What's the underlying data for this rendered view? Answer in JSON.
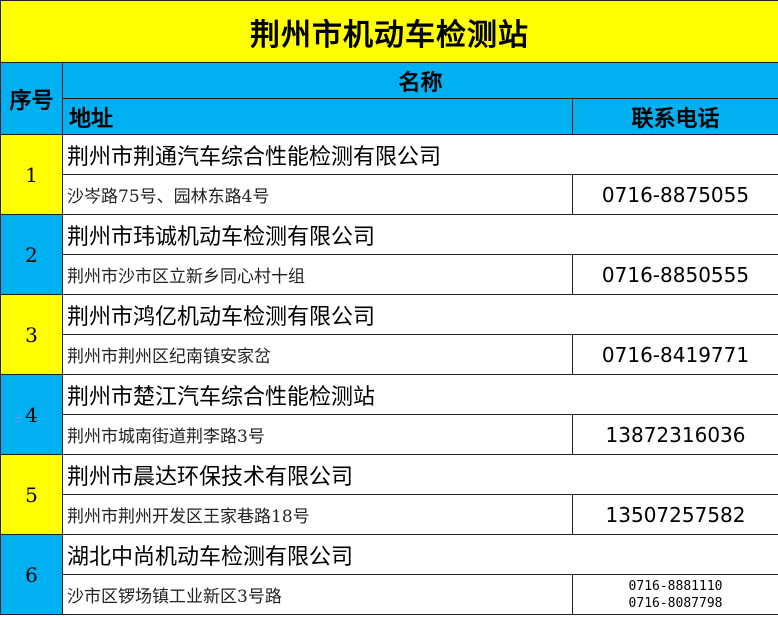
{
  "title": "荆州市机动车检测站",
  "headers": {
    "seq": "序号",
    "name": "名称",
    "address": "地址",
    "phone": "联系电话"
  },
  "colors": {
    "title_bg": "#ffff00",
    "header_bg": "#00b0f0",
    "seq_yellow": "#ffff00",
    "seq_blue": "#00b0f0"
  },
  "rows": [
    {
      "seq": "1",
      "name": "荆州市荆通汽车综合性能检测有限公司",
      "address": "沙岑路75号、园林东路4号",
      "phone": "0716-8875055"
    },
    {
      "seq": "2",
      "name": "荆州市玮诚机动车检测有限公司",
      "address": "荆州市沙市区立新乡同心村十组",
      "phone": "0716-8850555"
    },
    {
      "seq": "3",
      "name": "荆州市鸿亿机动车检测有限公司",
      "address": "荆州市荆州区纪南镇安家岔",
      "phone": "0716-8419771"
    },
    {
      "seq": "4",
      "name": "荆州市楚江汽车综合性能检测站",
      "address": "荆州市城南街道荆李路3号",
      "phone": "13872316036"
    },
    {
      "seq": "5",
      "name": "荆州市晨达环保技术有限公司",
      "address": "荆州市荆州开发区王家巷路18号",
      "phone": "13507257582"
    },
    {
      "seq": "6",
      "name": "湖北中尚机动车检测有限公司",
      "address": "沙市区锣场镇工业新区3号路",
      "phone": "0716-8881110",
      "phone2": "0716-8087798"
    }
  ]
}
